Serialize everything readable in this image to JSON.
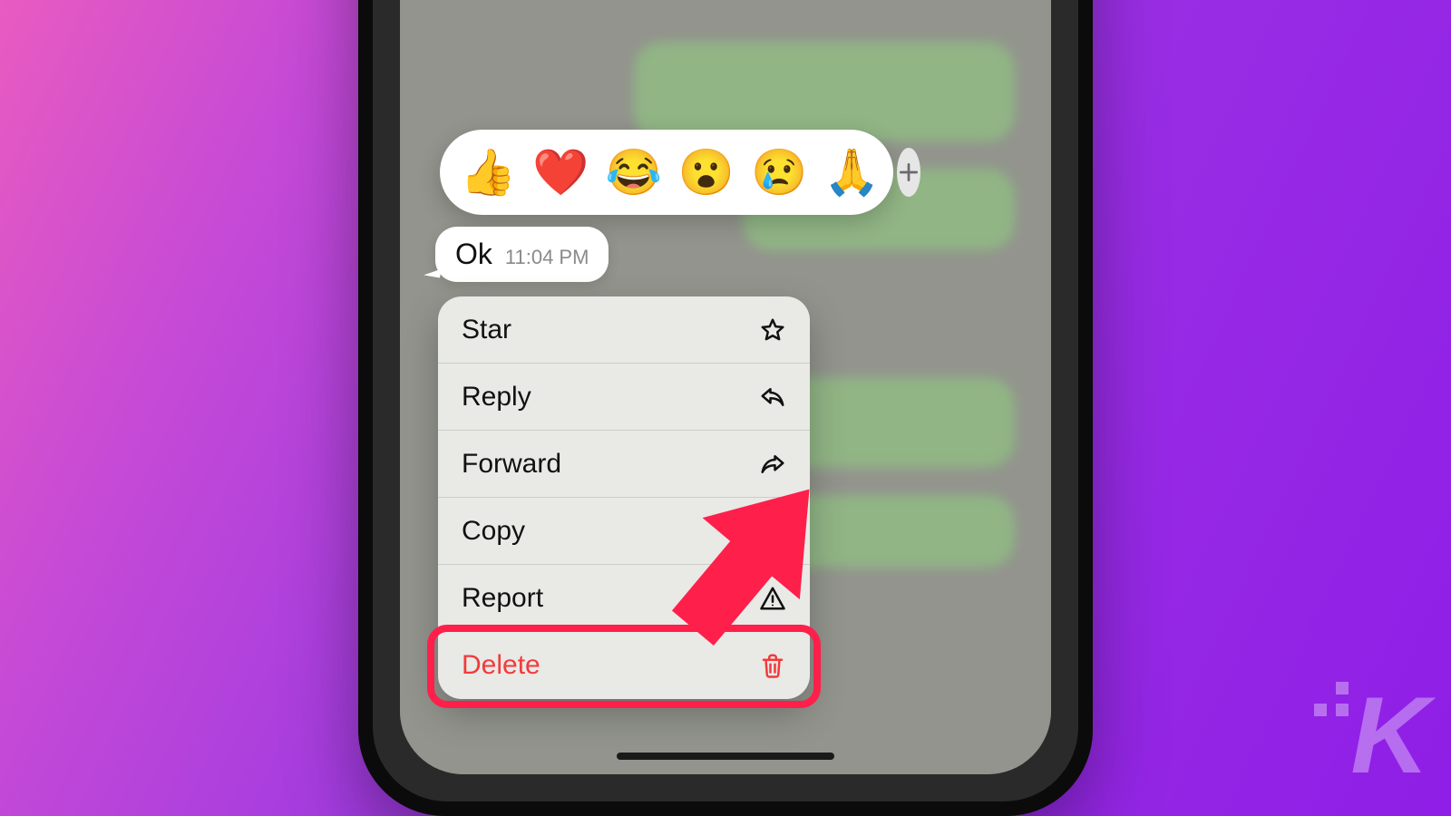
{
  "message": {
    "text": "Ok",
    "time": "11:04 PM"
  },
  "reactions": {
    "items": [
      "👍",
      "❤️",
      "😂",
      "😮",
      "😢",
      "🙏"
    ]
  },
  "menu": {
    "items": [
      {
        "label": "Star",
        "icon": "star-icon",
        "destructive": false
      },
      {
        "label": "Reply",
        "icon": "reply-icon",
        "destructive": false
      },
      {
        "label": "Forward",
        "icon": "forward-icon",
        "destructive": false
      },
      {
        "label": "Copy",
        "icon": "copy-icon",
        "destructive": false
      },
      {
        "label": "Report",
        "icon": "report-icon",
        "destructive": false
      },
      {
        "label": "Delete",
        "icon": "trash-icon",
        "destructive": true
      }
    ]
  },
  "watermark": "K",
  "annotation": {
    "highlight_target": "Delete",
    "arrow_color": "#ff1f4b"
  }
}
